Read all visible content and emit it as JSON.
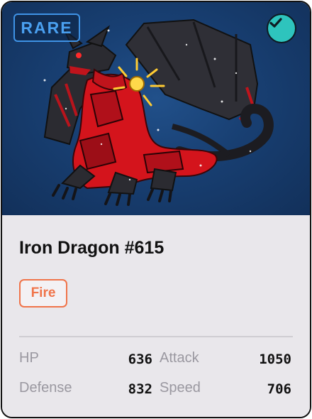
{
  "card": {
    "rarity": "RARE",
    "selected_icon": "checkmark-icon",
    "artwork": "iron-dragon-artwork",
    "name": "Iron Dragon #615",
    "type": "Fire",
    "stats": [
      {
        "label": "HP",
        "value": "636"
      },
      {
        "label": "Attack",
        "value": "1050"
      },
      {
        "label": "Defense",
        "value": "832"
      },
      {
        "label": "Speed",
        "value": "706"
      }
    ]
  },
  "colors": {
    "rarity_accent": "#3f93e6",
    "type_accent": "#f0744a",
    "check_accent": "#2ec4bd",
    "art_background": "#183f72",
    "dragon_red": "#d4141c",
    "dragon_dark": "#2b2b31"
  }
}
